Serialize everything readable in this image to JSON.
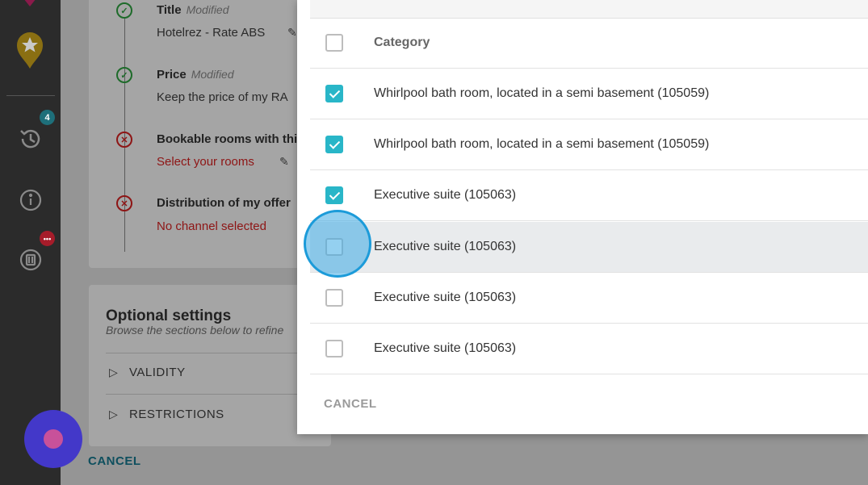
{
  "sidebar": {
    "history_badge": "4",
    "notifications_badge": "•••",
    "icons": [
      "star-marker-icon",
      "history-icon",
      "info-icon",
      "luggage-icon"
    ]
  },
  "steps": [
    {
      "title": "Title",
      "modified": "Modified",
      "value": "Hotelrez - Rate ABS",
      "status": "ok"
    },
    {
      "title": "Price",
      "modified": "Modified",
      "value": "Keep the price of my RA",
      "status": "ok"
    },
    {
      "title": "Bookable rooms with thi",
      "modified": "",
      "value": "Select your rooms",
      "status": "error"
    },
    {
      "title": "Distribution of my offer",
      "modified": "",
      "value": "No channel selected",
      "status": "error"
    }
  ],
  "optional": {
    "title": "Optional settings",
    "subtitle": "Browse the sections below to refine",
    "sections": [
      "VALIDITY",
      "RESTRICTIONS"
    ]
  },
  "page_cancel": "CANCEL",
  "modal": {
    "header": "Category",
    "rows": [
      {
        "label": "Whirlpool bath room, located in a semi basement (105059)",
        "checked": true
      },
      {
        "label": "Whirlpool bath room, located in a semi basement (105059)",
        "checked": true
      },
      {
        "label": "Executive suite (105063)",
        "checked": true
      },
      {
        "label": "Executive suite (105063)",
        "checked": false
      },
      {
        "label": "Executive suite (105063)",
        "checked": false
      },
      {
        "label": "Executive suite (105063)",
        "checked": false
      }
    ],
    "cancel_label": "CANCEL"
  },
  "colors": {
    "accent": "#29b6c8",
    "error": "#8e1515",
    "sidebar": "#2b2b2b",
    "fab": "#4338c9"
  }
}
